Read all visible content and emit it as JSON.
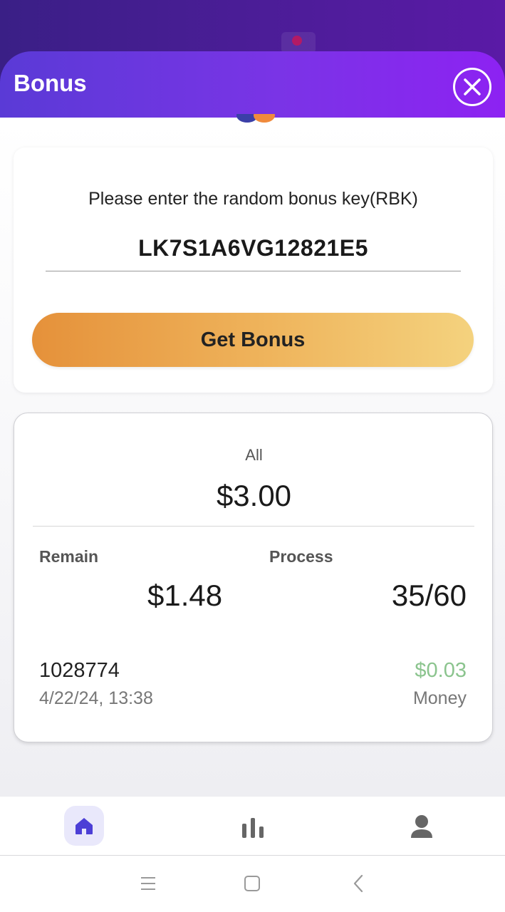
{
  "header": {
    "title": "Bonus"
  },
  "bonus_form": {
    "prompt": "Please enter the random bonus key(RBK)",
    "key_value": "LK7S1A6VG12821E5",
    "submit_label": "Get Bonus"
  },
  "summary": {
    "all_label": "All",
    "all_value": "$3.00",
    "remain_label": "Remain",
    "remain_value": "$1.48",
    "process_label": "Process",
    "process_value": "35/60"
  },
  "records": [
    {
      "id": "1028774",
      "date": "4/22/24, 13:38",
      "amount": "$0.03",
      "type": "Money"
    }
  ],
  "bottom_nav": {
    "items": [
      {
        "icon": "home-icon",
        "active": true
      },
      {
        "icon": "bar-chart-icon",
        "active": false
      },
      {
        "icon": "user-icon",
        "active": false
      }
    ]
  },
  "system_nav": {
    "icons": [
      "menu-icon",
      "home-square-icon",
      "back-chevron-icon"
    ]
  },
  "colors": {
    "header_gradient_start": "#5a3ad6",
    "header_gradient_end": "#8d22f2",
    "button_gradient_start": "#e5913a",
    "button_gradient_end": "#f4d27e",
    "positive_amount": "#8bc48e",
    "nav_active": "#4c3fd6"
  }
}
